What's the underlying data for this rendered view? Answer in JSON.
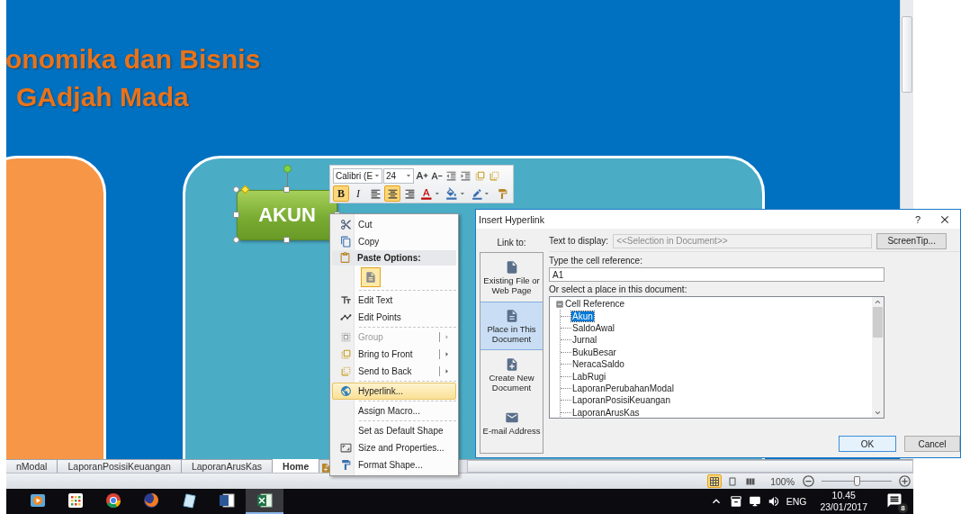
{
  "slide": {
    "title_lines": [
      "onomika dan Bisnis",
      "GAdjah Mada"
    ],
    "shape_label": "AKUN"
  },
  "mini_toolbar": {
    "font": "Calibri (E",
    "size": "24",
    "buttons": [
      {
        "kind": "bold",
        "label": "B",
        "selected": true
      },
      {
        "kind": "italic",
        "label": "I",
        "selected": false
      },
      {
        "kind": "align-left",
        "selected": false
      },
      {
        "kind": "align-center",
        "selected": true
      },
      {
        "kind": "align-right",
        "selected": false
      },
      {
        "kind": "font-color",
        "selected": false
      },
      {
        "kind": "fill-color",
        "selected": false
      },
      {
        "kind": "outline",
        "selected": false
      },
      {
        "kind": "format-painter",
        "selected": false
      }
    ]
  },
  "context_menu": {
    "items": [
      {
        "kind": "item",
        "label": "Cut",
        "disabled": false,
        "submenu": false,
        "selected": false
      },
      {
        "kind": "item",
        "label": "Copy",
        "disabled": false,
        "submenu": false,
        "selected": false
      },
      {
        "kind": "header",
        "label": "Paste Options:"
      },
      {
        "kind": "paste-options"
      },
      {
        "kind": "separator"
      },
      {
        "kind": "item",
        "label": "Edit Text",
        "disabled": false,
        "submenu": false,
        "selected": false
      },
      {
        "kind": "item",
        "label": "Edit Points",
        "disabled": false,
        "submenu": false,
        "selected": false
      },
      {
        "kind": "separator"
      },
      {
        "kind": "item",
        "label": "Group",
        "disabled": true,
        "submenu": true,
        "selected": false
      },
      {
        "kind": "item",
        "label": "Bring to Front",
        "disabled": false,
        "submenu": true,
        "selected": false
      },
      {
        "kind": "item",
        "label": "Send to Back",
        "disabled": false,
        "submenu": true,
        "selected": false
      },
      {
        "kind": "separator"
      },
      {
        "kind": "item",
        "label": "Hyperlink...",
        "disabled": false,
        "submenu": false,
        "selected": true
      },
      {
        "kind": "separator"
      },
      {
        "kind": "item",
        "label": "Assign Macro...",
        "disabled": false,
        "submenu": false,
        "selected": false
      },
      {
        "kind": "separator"
      },
      {
        "kind": "item",
        "label": "Set as Default Shape",
        "disabled": false,
        "submenu": false,
        "selected": false
      },
      {
        "kind": "item",
        "label": "Size and Properties...",
        "disabled": false,
        "submenu": false,
        "selected": false
      },
      {
        "kind": "item",
        "label": "Format Shape...",
        "disabled": false,
        "submenu": false,
        "selected": false
      }
    ]
  },
  "dialog": {
    "title": "Insert Hyperlink",
    "help": "?",
    "link_to_label": "Link to:",
    "link_options": [
      {
        "label": "Existing File or Web Page",
        "selected": false
      },
      {
        "label": "Place in This Document",
        "selected": true
      },
      {
        "label": "Create New Document",
        "selected": false
      },
      {
        "label": "E-mail Address",
        "selected": false
      }
    ],
    "text_to_display": {
      "label": "Text to display:",
      "value": "<<Selection in Document>>",
      "disabled": true
    },
    "screentip_button": "ScreenTip...",
    "cell_reference": {
      "label": "Type the cell reference:",
      "value": "A1"
    },
    "place_label": "Or select a place in this document:",
    "tree": [
      {
        "label": "Cell Reference",
        "expanded": true,
        "children": [
          {
            "label": "Akun",
            "selected": true
          },
          {
            "label": "SaldoAwal",
            "selected": false
          },
          {
            "label": "Jurnal",
            "selected": false
          },
          {
            "label": "BukuBesar",
            "selected": false
          },
          {
            "label": "NeracaSaldo",
            "selected": false
          },
          {
            "label": "LabRugi",
            "selected": false
          },
          {
            "label": "LaporanPerubahanModal",
            "selected": false
          },
          {
            "label": "LaporanPosisiKeuangan",
            "selected": false
          },
          {
            "label": "LaporanArusKas",
            "selected": false
          }
        ]
      }
    ],
    "buttons": [
      {
        "label": "OK",
        "default": true
      },
      {
        "label": "Cancel",
        "default": false
      }
    ]
  },
  "sheet_tabs": [
    {
      "label": "nModal",
      "selected": false
    },
    {
      "label": "LaporanPosisiKeuangan",
      "selected": false
    },
    {
      "label": "LaporanArusKas",
      "selected": false
    },
    {
      "label": "Home",
      "selected": true
    }
  ],
  "status_bar": {
    "views": [
      {
        "selected": true
      },
      {
        "selected": false
      },
      {
        "selected": false
      }
    ],
    "zoom_text": "100%",
    "zoom": {
      "level": 0.5
    }
  },
  "taskbar": {
    "apps": [
      {
        "selected": false
      },
      {
        "selected": false
      },
      {
        "selected": false
      },
      {
        "selected": false
      },
      {
        "selected": false
      },
      {
        "selected": false
      },
      {
        "selected": true
      }
    ],
    "language": "ENG",
    "time": "10.45",
    "date": "23/01/2017",
    "notification_count": "8"
  }
}
